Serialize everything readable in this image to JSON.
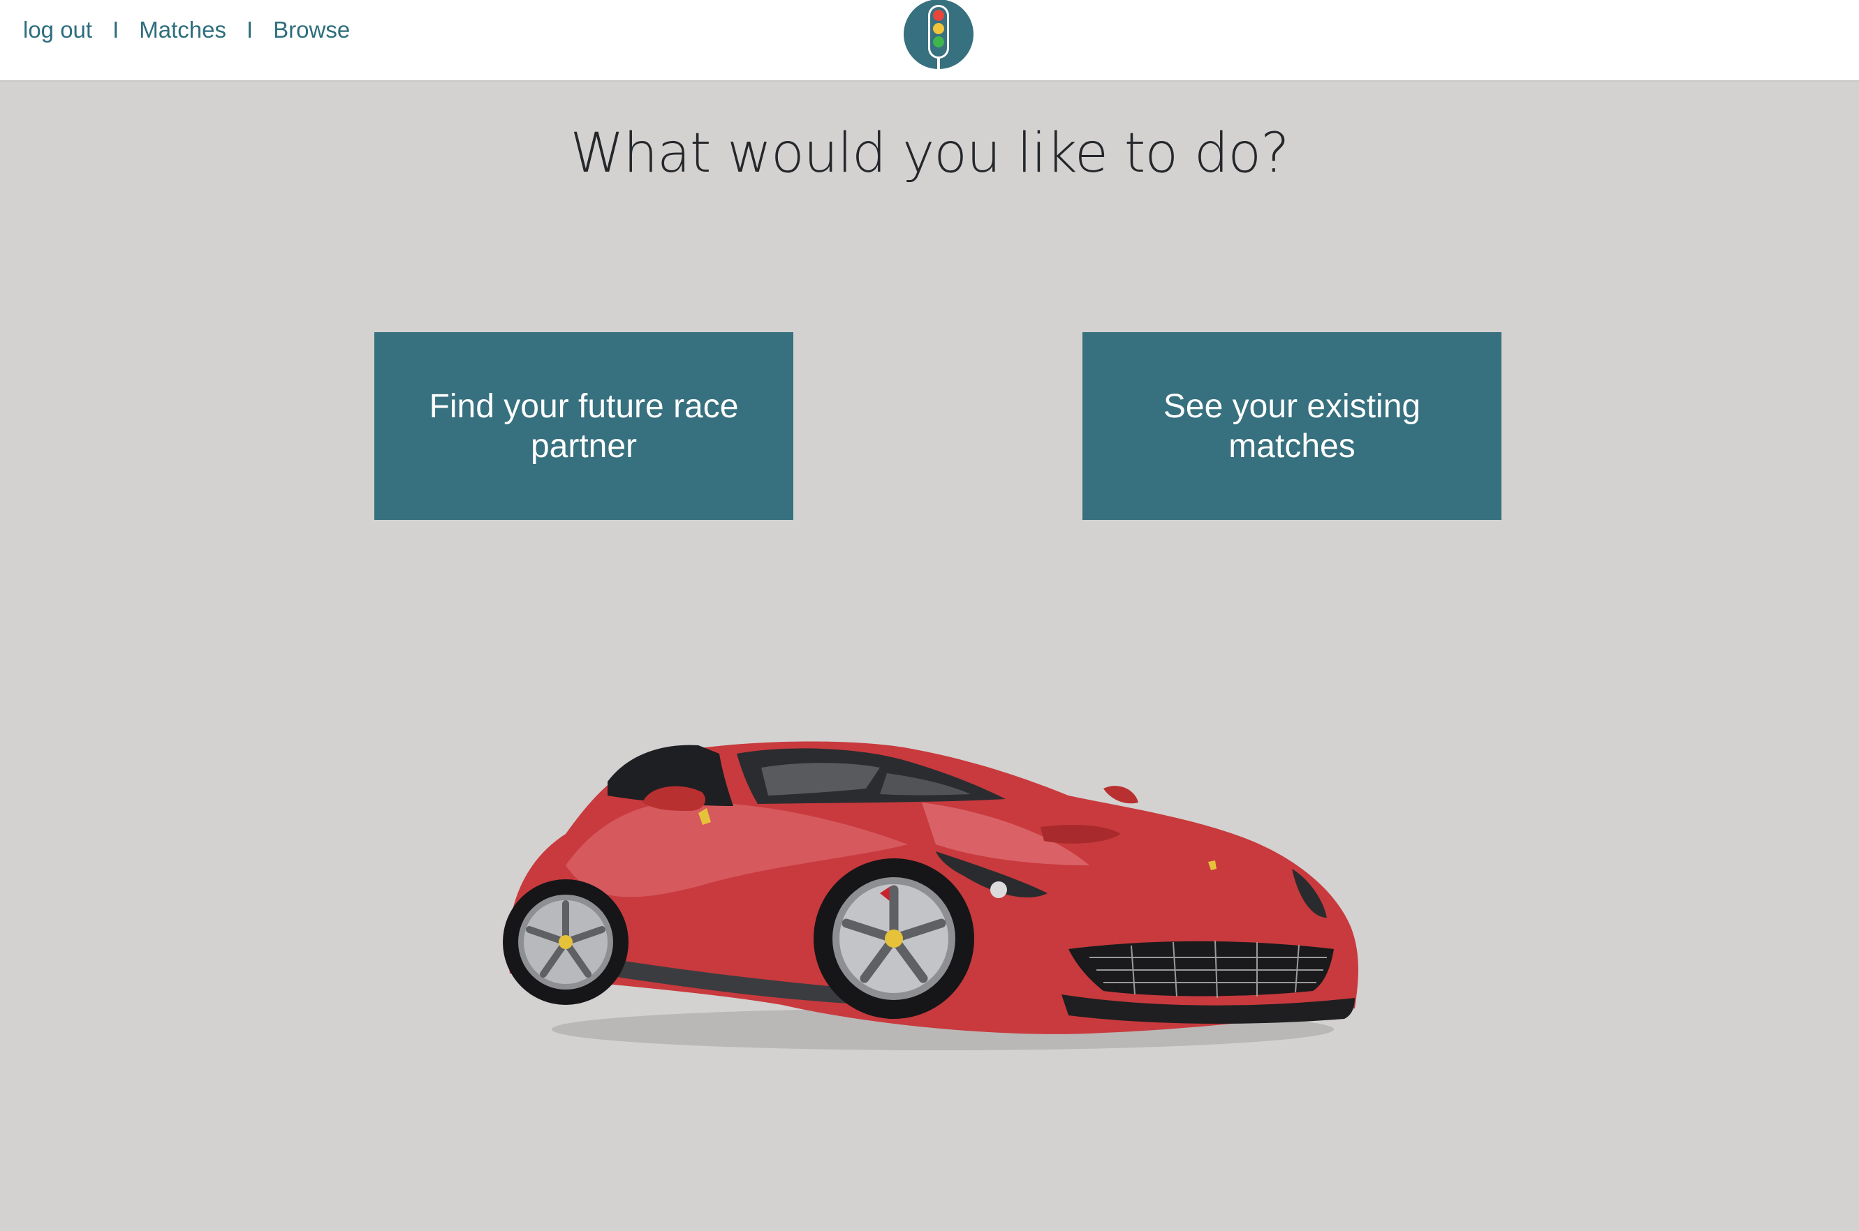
{
  "nav": {
    "logout": "log out",
    "separator": "I",
    "matches": "Matches",
    "browse": "Browse"
  },
  "logo": {
    "icon": "traffic-light-icon"
  },
  "main": {
    "heading": "What would you like to do?",
    "buttons": [
      {
        "label": "Find your future race partner"
      },
      {
        "label": "See your existing matches"
      }
    ],
    "image": {
      "icon": "red-sports-car-image"
    }
  },
  "colors": {
    "accent": "#37707e",
    "nav_text": "#2e6e7d",
    "background": "#d3d2d1",
    "header_bg": "#ffffff"
  }
}
